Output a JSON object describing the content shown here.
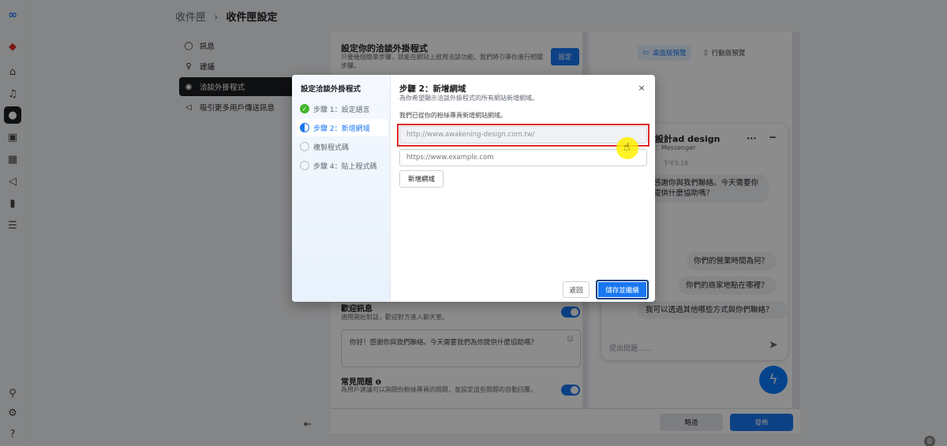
{
  "rail": {
    "logo": "meta-logo-icon",
    "icons": [
      "notification-badge-icon",
      "home-icon",
      "bell-icon",
      "chat-icon",
      "pages-icon",
      "table-icon",
      "megaphone-icon",
      "chart-icon",
      "menu-icon"
    ],
    "bottom_icons": [
      "search-icon",
      "gear-icon",
      "help-icon"
    ]
  },
  "breadcrumb": {
    "root": "收件匣",
    "separator": "›",
    "current": "收件匣設定"
  },
  "sidebar": {
    "items": [
      {
        "label": "訊息",
        "icon": "chat-bubble-icon"
      },
      {
        "label": "建議",
        "icon": "lightbulb-icon"
      },
      {
        "label": "洽談外掛程式",
        "icon": "messenger-icon"
      },
      {
        "label": "吸引更多用戶傳送訊息",
        "icon": "megaphone-icon"
      }
    ]
  },
  "main": {
    "title": "設定你的洽談外掛程式",
    "desc": "只要幾個簡單步驟，就能在網站上啟用洽談功能，我們將引導你進行相關步驟。",
    "setup_button": "設定",
    "welcome_title": "歡迎訊息",
    "welcome_desc": "適用開始對話，歡迎對方進入聊天室。",
    "welcome_text": "你好！感謝你與我們聯絡。今天需要我們為你提供什麼協助嗎？",
    "faq_title": "常見問題",
    "faq_desc": "為用戶建議可以詢問你粉絲專頁的問題，並設定這些問題的自動回覆。"
  },
  "preview": {
    "tab_desktop": "桌面版預覽",
    "tab_mobile": "行動版預覽",
    "page_name": "設計ad design",
    "page_sub": "：Messenger",
    "time": "下午5:18",
    "greeting": "感謝你與我們聯絡。今天需要你提供什麼協助嗎？",
    "questions": [
      "你們的營業時間為何？",
      "你們的商家地點在哪裡？",
      "我可以透過其他哪些方式與你們聯絡？"
    ],
    "input_placeholder": "提出問題......"
  },
  "footer": {
    "skip": "略過",
    "publish": "發佈"
  },
  "modal": {
    "left_title": "設定洽談外掛程式",
    "steps": [
      {
        "label": "步驟 1：設定語言",
        "state": "done"
      },
      {
        "label": "步驟 2：新增網域",
        "state": "current"
      },
      {
        "label": "複製程式碼",
        "state": "todo"
      },
      {
        "label": "步驟 4：貼上程式碼",
        "state": "todo"
      }
    ],
    "title": "步驟 2：新增網域",
    "subtitle": "為你希望顯示洽談外掛程式的所有網站新增網域。",
    "note": "我們已從你的粉絲專頁新增網站網域。",
    "existing_domain": "http://www.awakening-design.com.tw/",
    "new_domain_placeholder": "https://www.example.com",
    "add_domain": "新增網域",
    "back": "返回",
    "save": "儲存並繼續",
    "close": "×"
  }
}
